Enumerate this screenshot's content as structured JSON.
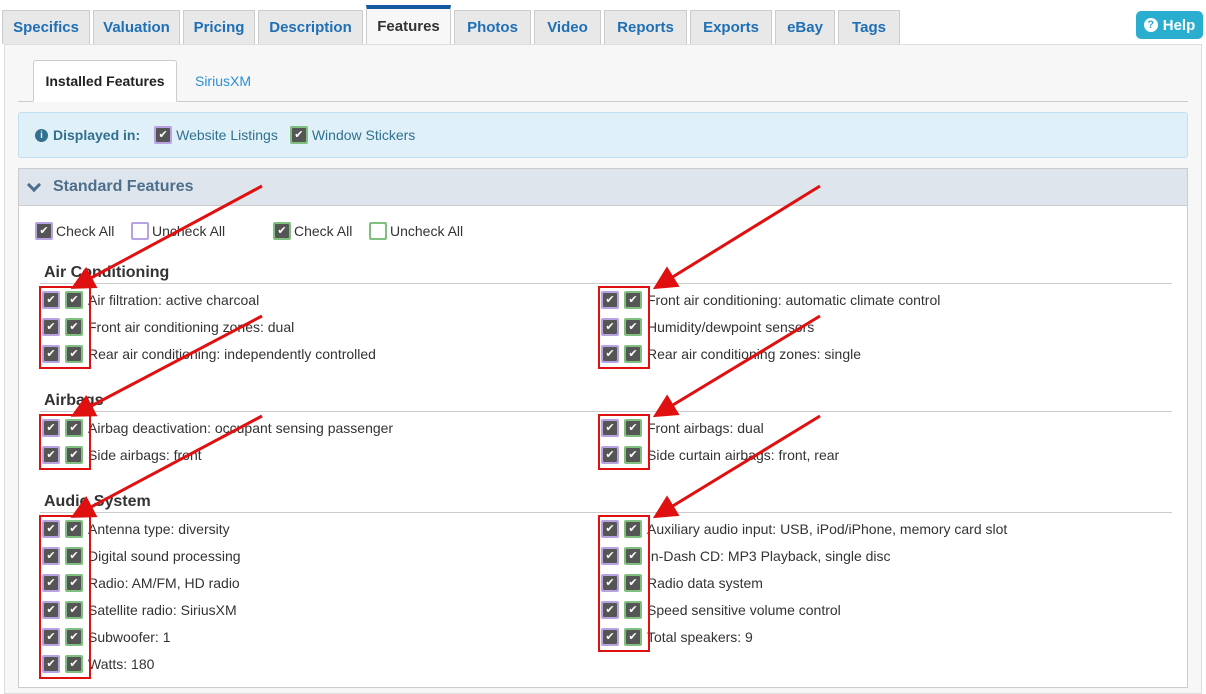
{
  "tabs": [
    "Specifics",
    "Valuation",
    "Pricing",
    "Description",
    "Features",
    "Photos",
    "Video",
    "Reports",
    "Exports",
    "eBay",
    "Tags"
  ],
  "help_label": "Help",
  "subtabs": [
    "Installed Features",
    "SiriusXM"
  ],
  "info": {
    "prefix": "Displayed in:",
    "website": "Website Listings",
    "window": "Window Stickers"
  },
  "section_title": "Standard Features",
  "controls": {
    "check_all": "Check All",
    "uncheck_all": "Uncheck All"
  },
  "groups": [
    {
      "title": "Air Conditioning",
      "left": [
        "Air filtration: active charcoal",
        "Front air conditioning zones: dual",
        "Rear air conditioning: independently controlled"
      ],
      "right": [
        "Front air conditioning: automatic climate control",
        "Humidity/dewpoint sensors",
        "Rear air conditioning zones: single"
      ]
    },
    {
      "title": "Airbags",
      "left": [
        "Airbag deactivation: occupant sensing passenger",
        "Side airbags: front"
      ],
      "right": [
        "Front airbags: dual",
        "Side curtain airbags: front, rear"
      ]
    },
    {
      "title": "Audio System",
      "left": [
        "Antenna type: diversity",
        "Digital sound processing",
        "Radio: AM/FM, HD radio",
        "Satellite radio: SiriusXM",
        "Subwoofer: 1",
        "Watts: 180"
      ],
      "right": [
        "Auxiliary audio input: USB, iPod/iPhone, memory card slot",
        "In-Dash CD: MP3 Playback, single disc",
        "Radio data system",
        "Speed sensitive volume control",
        "Total speakers: 9"
      ]
    }
  ],
  "colors": {
    "website": "#b9a2e3",
    "window": "#7fbf7f",
    "annotation": "#e01010",
    "accent": "#1457a0"
  },
  "icons": {
    "help": "question-circle-icon",
    "info": "info-circle-icon",
    "collapse": "chevron-down-icon"
  }
}
